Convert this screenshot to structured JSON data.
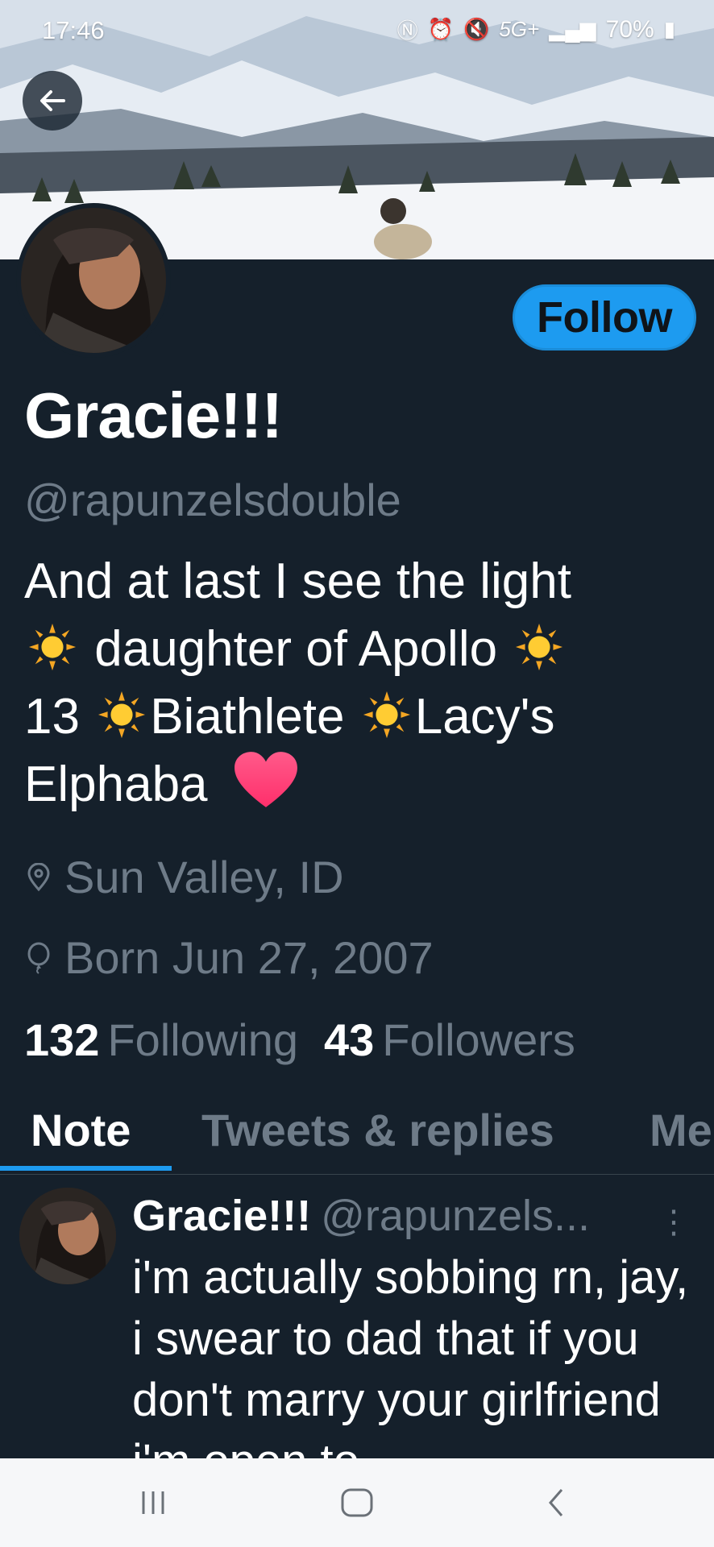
{
  "status_bar": {
    "time": "17:46",
    "network": "5G+",
    "battery": "70%",
    "icons": [
      "nfc-icon",
      "alarm-icon",
      "mute-icon",
      "signal-icon",
      "battery-icon"
    ]
  },
  "profile": {
    "display_name": "Gracie!!!",
    "handle": "@rapunzelsdouble",
    "follow_label": "Follow",
    "bio": {
      "line1": "And at last I see the light",
      "part2": "daughter of Apollo",
      "part3a": "13",
      "part3b": "Biathlete",
      "part3c": "Lacy's",
      "part4": "Elphaba"
    },
    "location": "Sun Valley, ID",
    "birthday": "Born Jun 27, 2007",
    "following_count": "132",
    "following_label": "Following",
    "followers_count": "43",
    "followers_label": "Followers"
  },
  "tabs": [
    {
      "label": "Note",
      "active": true
    },
    {
      "label": "Tweets & replies",
      "active": false
    },
    {
      "label": "Me",
      "active": false
    }
  ],
  "tweet": {
    "name": "Gracie!!!",
    "handle": "@rapunzels...",
    "more": "⋮",
    "text": "i'm actually sobbing rn, jay, i swear to dad that if you don't marry your girlfriend i'm open to"
  },
  "colors": {
    "background": "#15202b",
    "accent": "#1d9bf0",
    "muted_text": "#6e7b88"
  }
}
